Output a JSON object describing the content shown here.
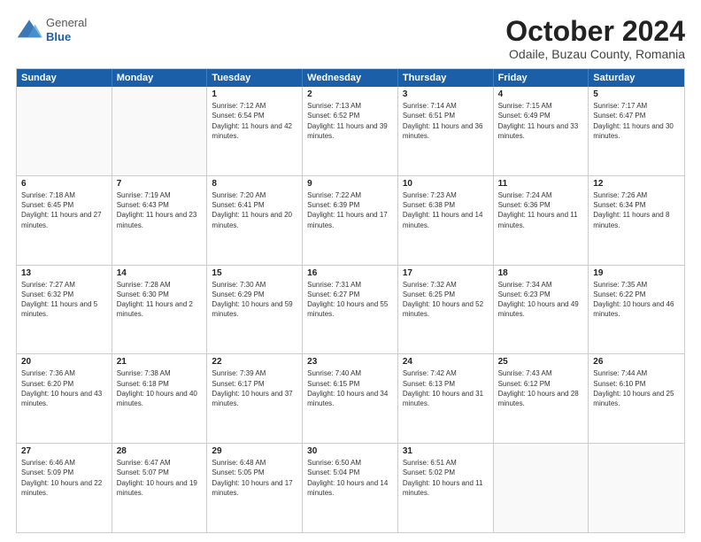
{
  "logo": {
    "general": "General",
    "blue": "Blue"
  },
  "title": "October 2024",
  "subtitle": "Odaile, Buzau County, Romania",
  "header_days": [
    "Sunday",
    "Monday",
    "Tuesday",
    "Wednesday",
    "Thursday",
    "Friday",
    "Saturday"
  ],
  "weeks": [
    [
      {
        "day": "",
        "sunrise": "",
        "sunset": "",
        "daylight": ""
      },
      {
        "day": "",
        "sunrise": "",
        "sunset": "",
        "daylight": ""
      },
      {
        "day": "1",
        "sunrise": "Sunrise: 7:12 AM",
        "sunset": "Sunset: 6:54 PM",
        "daylight": "Daylight: 11 hours and 42 minutes."
      },
      {
        "day": "2",
        "sunrise": "Sunrise: 7:13 AM",
        "sunset": "Sunset: 6:52 PM",
        "daylight": "Daylight: 11 hours and 39 minutes."
      },
      {
        "day": "3",
        "sunrise": "Sunrise: 7:14 AM",
        "sunset": "Sunset: 6:51 PM",
        "daylight": "Daylight: 11 hours and 36 minutes."
      },
      {
        "day": "4",
        "sunrise": "Sunrise: 7:15 AM",
        "sunset": "Sunset: 6:49 PM",
        "daylight": "Daylight: 11 hours and 33 minutes."
      },
      {
        "day": "5",
        "sunrise": "Sunrise: 7:17 AM",
        "sunset": "Sunset: 6:47 PM",
        "daylight": "Daylight: 11 hours and 30 minutes."
      }
    ],
    [
      {
        "day": "6",
        "sunrise": "Sunrise: 7:18 AM",
        "sunset": "Sunset: 6:45 PM",
        "daylight": "Daylight: 11 hours and 27 minutes."
      },
      {
        "day": "7",
        "sunrise": "Sunrise: 7:19 AM",
        "sunset": "Sunset: 6:43 PM",
        "daylight": "Daylight: 11 hours and 23 minutes."
      },
      {
        "day": "8",
        "sunrise": "Sunrise: 7:20 AM",
        "sunset": "Sunset: 6:41 PM",
        "daylight": "Daylight: 11 hours and 20 minutes."
      },
      {
        "day": "9",
        "sunrise": "Sunrise: 7:22 AM",
        "sunset": "Sunset: 6:39 PM",
        "daylight": "Daylight: 11 hours and 17 minutes."
      },
      {
        "day": "10",
        "sunrise": "Sunrise: 7:23 AM",
        "sunset": "Sunset: 6:38 PM",
        "daylight": "Daylight: 11 hours and 14 minutes."
      },
      {
        "day": "11",
        "sunrise": "Sunrise: 7:24 AM",
        "sunset": "Sunset: 6:36 PM",
        "daylight": "Daylight: 11 hours and 11 minutes."
      },
      {
        "day": "12",
        "sunrise": "Sunrise: 7:26 AM",
        "sunset": "Sunset: 6:34 PM",
        "daylight": "Daylight: 11 hours and 8 minutes."
      }
    ],
    [
      {
        "day": "13",
        "sunrise": "Sunrise: 7:27 AM",
        "sunset": "Sunset: 6:32 PM",
        "daylight": "Daylight: 11 hours and 5 minutes."
      },
      {
        "day": "14",
        "sunrise": "Sunrise: 7:28 AM",
        "sunset": "Sunset: 6:30 PM",
        "daylight": "Daylight: 11 hours and 2 minutes."
      },
      {
        "day": "15",
        "sunrise": "Sunrise: 7:30 AM",
        "sunset": "Sunset: 6:29 PM",
        "daylight": "Daylight: 10 hours and 59 minutes."
      },
      {
        "day": "16",
        "sunrise": "Sunrise: 7:31 AM",
        "sunset": "Sunset: 6:27 PM",
        "daylight": "Daylight: 10 hours and 55 minutes."
      },
      {
        "day": "17",
        "sunrise": "Sunrise: 7:32 AM",
        "sunset": "Sunset: 6:25 PM",
        "daylight": "Daylight: 10 hours and 52 minutes."
      },
      {
        "day": "18",
        "sunrise": "Sunrise: 7:34 AM",
        "sunset": "Sunset: 6:23 PM",
        "daylight": "Daylight: 10 hours and 49 minutes."
      },
      {
        "day": "19",
        "sunrise": "Sunrise: 7:35 AM",
        "sunset": "Sunset: 6:22 PM",
        "daylight": "Daylight: 10 hours and 46 minutes."
      }
    ],
    [
      {
        "day": "20",
        "sunrise": "Sunrise: 7:36 AM",
        "sunset": "Sunset: 6:20 PM",
        "daylight": "Daylight: 10 hours and 43 minutes."
      },
      {
        "day": "21",
        "sunrise": "Sunrise: 7:38 AM",
        "sunset": "Sunset: 6:18 PM",
        "daylight": "Daylight: 10 hours and 40 minutes."
      },
      {
        "day": "22",
        "sunrise": "Sunrise: 7:39 AM",
        "sunset": "Sunset: 6:17 PM",
        "daylight": "Daylight: 10 hours and 37 minutes."
      },
      {
        "day": "23",
        "sunrise": "Sunrise: 7:40 AM",
        "sunset": "Sunset: 6:15 PM",
        "daylight": "Daylight: 10 hours and 34 minutes."
      },
      {
        "day": "24",
        "sunrise": "Sunrise: 7:42 AM",
        "sunset": "Sunset: 6:13 PM",
        "daylight": "Daylight: 10 hours and 31 minutes."
      },
      {
        "day": "25",
        "sunrise": "Sunrise: 7:43 AM",
        "sunset": "Sunset: 6:12 PM",
        "daylight": "Daylight: 10 hours and 28 minutes."
      },
      {
        "day": "26",
        "sunrise": "Sunrise: 7:44 AM",
        "sunset": "Sunset: 6:10 PM",
        "daylight": "Daylight: 10 hours and 25 minutes."
      }
    ],
    [
      {
        "day": "27",
        "sunrise": "Sunrise: 6:46 AM",
        "sunset": "Sunset: 5:09 PM",
        "daylight": "Daylight: 10 hours and 22 minutes."
      },
      {
        "day": "28",
        "sunrise": "Sunrise: 6:47 AM",
        "sunset": "Sunset: 5:07 PM",
        "daylight": "Daylight: 10 hours and 19 minutes."
      },
      {
        "day": "29",
        "sunrise": "Sunrise: 6:48 AM",
        "sunset": "Sunset: 5:05 PM",
        "daylight": "Daylight: 10 hours and 17 minutes."
      },
      {
        "day": "30",
        "sunrise": "Sunrise: 6:50 AM",
        "sunset": "Sunset: 5:04 PM",
        "daylight": "Daylight: 10 hours and 14 minutes."
      },
      {
        "day": "31",
        "sunrise": "Sunrise: 6:51 AM",
        "sunset": "Sunset: 5:02 PM",
        "daylight": "Daylight: 10 hours and 11 minutes."
      },
      {
        "day": "",
        "sunrise": "",
        "sunset": "",
        "daylight": ""
      },
      {
        "day": "",
        "sunrise": "",
        "sunset": "",
        "daylight": ""
      }
    ]
  ]
}
